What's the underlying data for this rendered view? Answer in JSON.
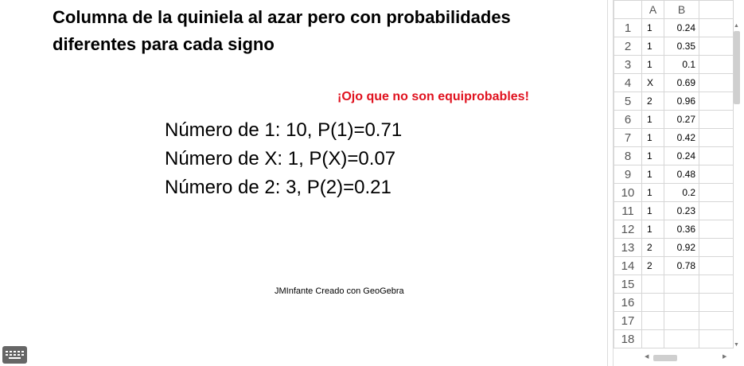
{
  "graphics": {
    "title": "Columna de la quiniela al azar pero con probabilidades diferentes para cada signo",
    "warning": "¡Ojo que no son equiprobables!",
    "counts": [
      "Número de 1: 10, P(1)=0.71",
      "Número de X: 1, P(X)=0.07",
      "Número de 2: 3, P(2)=0.21"
    ],
    "credit": "JMInfante Creado con GeoGebra",
    "keyboard_icon": "keyboard-icon"
  },
  "colors": {
    "warning": "#e0121f",
    "keyboard": "#666666"
  },
  "spreadsheet": {
    "columns": [
      "A",
      "B"
    ],
    "rows": [
      {
        "n": "1",
        "a": "1",
        "b": "0.24"
      },
      {
        "n": "2",
        "a": "1",
        "b": "0.35"
      },
      {
        "n": "3",
        "a": "1",
        "b": "0.1"
      },
      {
        "n": "4",
        "a": "X",
        "b": "0.69"
      },
      {
        "n": "5",
        "a": "2",
        "b": "0.96"
      },
      {
        "n": "6",
        "a": "1",
        "b": "0.27"
      },
      {
        "n": "7",
        "a": "1",
        "b": "0.42"
      },
      {
        "n": "8",
        "a": "1",
        "b": "0.24"
      },
      {
        "n": "9",
        "a": "1",
        "b": "0.48"
      },
      {
        "n": "10",
        "a": "1",
        "b": "0.2"
      },
      {
        "n": "11",
        "a": "1",
        "b": "0.23"
      },
      {
        "n": "12",
        "a": "1",
        "b": "0.36"
      },
      {
        "n": "13",
        "a": "2",
        "b": "0.92"
      },
      {
        "n": "14",
        "a": "2",
        "b": "0.78"
      },
      {
        "n": "15",
        "a": "",
        "b": ""
      },
      {
        "n": "16",
        "a": "",
        "b": ""
      },
      {
        "n": "17",
        "a": "",
        "b": ""
      },
      {
        "n": "18",
        "a": "",
        "b": ""
      }
    ]
  }
}
